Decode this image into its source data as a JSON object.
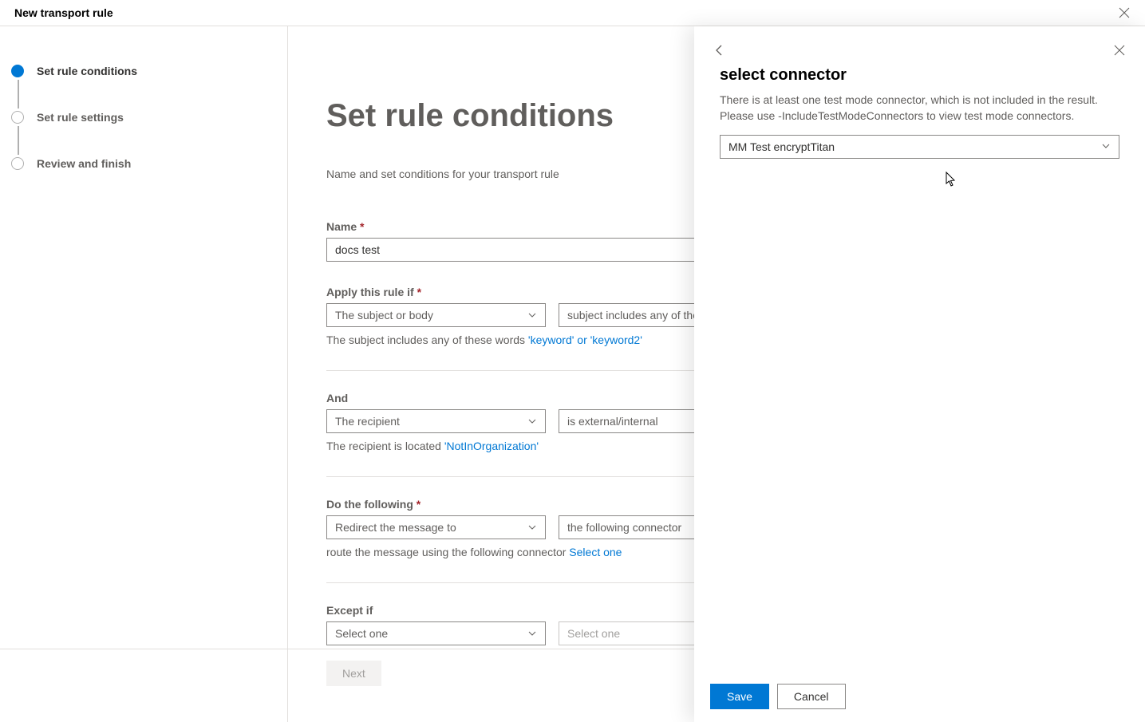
{
  "header": {
    "title": "New transport rule"
  },
  "steps": [
    {
      "label": "Set rule conditions",
      "active": true
    },
    {
      "label": "Set rule settings",
      "active": false
    },
    {
      "label": "Review and finish",
      "active": false
    }
  ],
  "main": {
    "heading": "Set rule conditions",
    "subtitle": "Name and set conditions for your transport rule",
    "name_label": "Name",
    "name_value": "docs test",
    "apply_label": "Apply this rule if",
    "apply_primary": "The subject or body",
    "apply_secondary": "subject includes any of these words",
    "apply_helper_prefix": "The subject includes any of these words ",
    "apply_helper_link": "'keyword' or 'keyword2'",
    "and_label": "And",
    "and_primary": "The recipient",
    "and_secondary": "is external/internal",
    "and_helper_prefix": "The recipient is located ",
    "and_helper_link": "'NotInOrganization'",
    "do_label": "Do the following",
    "do_primary": "Redirect the message to",
    "do_secondary": "the following connector",
    "do_helper_prefix": "route the message using the following connector ",
    "do_helper_link": "Select one",
    "except_label": "Except if",
    "except_primary": "Select one",
    "except_secondary": "Select one",
    "next_label": "Next"
  },
  "panel": {
    "title": "select connector",
    "help": "There is at least one test mode connector, which is not included in the result. Please use -IncludeTestModeConnectors to view test mode connectors.",
    "selected": "MM Test encryptTitan",
    "save_label": "Save",
    "cancel_label": "Cancel"
  }
}
